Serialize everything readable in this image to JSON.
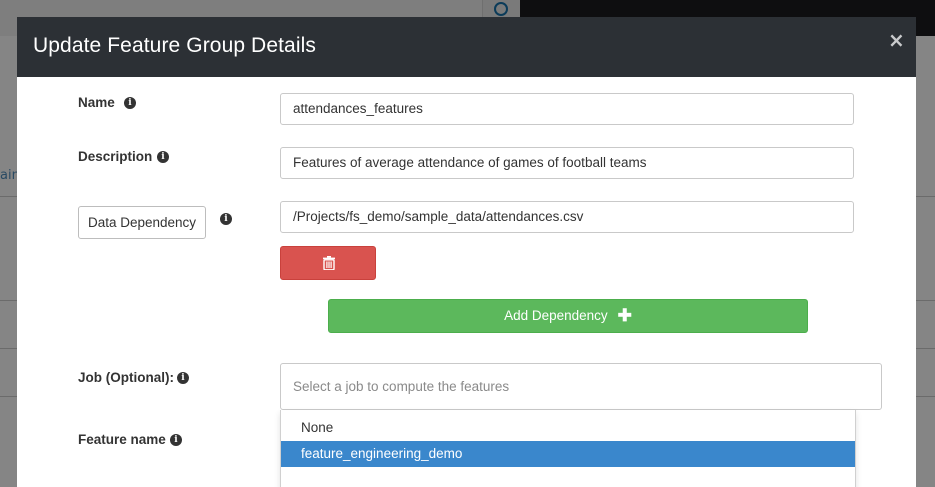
{
  "modal": {
    "title": "Update Feature Group Details",
    "close_glyph": "×"
  },
  "background": {
    "sidebar_fragment": "aini",
    "search_icon": "search-icon"
  },
  "form": {
    "name": {
      "label": "Name",
      "value": "attendances_features"
    },
    "description": {
      "label": "Description",
      "value": "Features of average attendance of games of football teams"
    },
    "data_dependency": {
      "button_label": "Data Dependency",
      "value": "/Projects/fs_demo/sample_data/attendances.csv",
      "delete_icon": "trash-icon"
    },
    "add_dependency": {
      "label": "Add Dependency",
      "icon": "plus-icon"
    },
    "job": {
      "label": "Job (Optional):",
      "placeholder": "Select a job to compute the features",
      "options": [
        "None",
        "feature_engineering_demo"
      ],
      "highlighted_option": "feature_engineering_demo"
    },
    "feature_name": {
      "label": "Feature name"
    }
  },
  "colors": {
    "header_bg": "#2c3035",
    "danger": "#d9534f",
    "success": "#5cb85c",
    "highlight": "#3a87cc"
  }
}
